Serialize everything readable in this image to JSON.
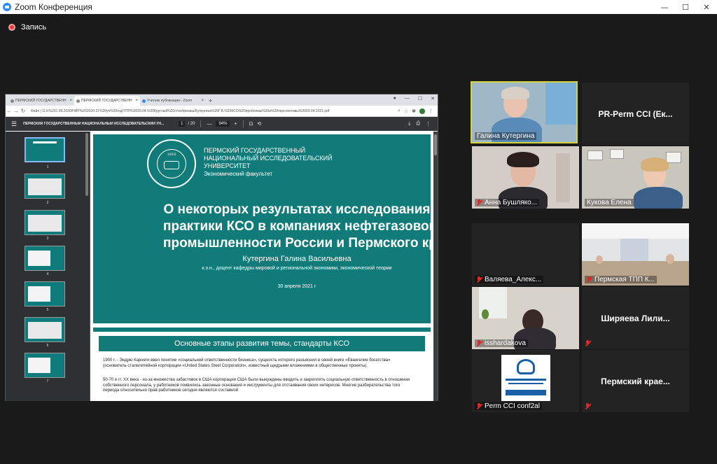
{
  "window": {
    "title": "Zoom Конференция",
    "minimize": "—",
    "maximize": "☐",
    "close": "✕"
  },
  "recording": {
    "label": "Запись"
  },
  "browser": {
    "tabs": [
      {
        "label": "ПЕРМСКИЙ ГОСУДАРСТВЕНН",
        "active": false
      },
      {
        "label": "ПЕРМСКИЙ ГОСУДАРСТВЕНН",
        "active": true
      },
      {
        "label": "Учетник публикации - Zoom",
        "active": false
      }
    ],
    "new_tab": "+",
    "url": "Файл | G:/с%201.09.2020/НИР%202020-21%20уч%20год/ТПП%2029.04.%20Круглый%20стол/финиш/Кутергина%20Г.В.%20КСО%20проблемы%20и%20перспективы%2029.04.2021.pdf"
  },
  "pdf": {
    "doc_title": "ПЕРМСКИЙ ГОСУДАРСТВЕННЫЙ НАЦИОНАЛЬНЫЙ ИССЛЕДОВАТЕЛЬСКИЙ УН...",
    "page_current": "1",
    "page_total": "/ 20",
    "zoom": "94%",
    "thumbnail_numbers": [
      "1",
      "2",
      "3",
      "4",
      "5",
      "6",
      "7"
    ]
  },
  "slide1": {
    "seal_year": "1916",
    "university_lines": [
      "ПЕРМСКИЙ ГОСУДАРСТВЕННЫЙ",
      "НАЦИОНАЛЬНЫЙ ИССЛЕДОВАТЕЛЬСКИЙ",
      "УНИВЕРСИТЕТ"
    ],
    "faculty": "Экономический факультет",
    "title_lines": [
      "О некоторых результатах исследования",
      "практики КСО в компаниях нефтегазовой",
      "промышленности России и Пермского края"
    ],
    "author": "Кутергина Галина Васильевна",
    "degree": "к.э.н., доцент кафедры мировой и региональной экономики, экономической теории",
    "date": "30 апреля 2021 г"
  },
  "slide2": {
    "heading": "Основные этапы развития темы, стандарты КСО",
    "p1": "1900 г. - Эндрю Карнеги ввел понятие «социальной ответственности бизнеса», сущность которого разъяснил в своей книге «Евангелие богатства» (основатель сталелитейной корпорации «United States Steel Corporation», известный щедрыми вложениями в общественные проекты).",
    "p2": "50-70 е гг. XX века - из-за множества забастовок в США корпорации США были вынуждены вводить и закреплять социальную ответственность в отношении собственного персонала, у работников появились законные основания и инструменты для отстаивания своих интересов. Многие разбирательства того периода относительно прав работников сегодня являются составной"
  },
  "participants": [
    {
      "name": "Галина Кутергина",
      "muted": false,
      "video": true
    },
    {
      "name": "PR-Perm CCI (Ек...",
      "muted": false,
      "video": false
    },
    {
      "name": "Анна Бушляко...",
      "muted": true,
      "video": true
    },
    {
      "name": "Кукова Елена",
      "muted": false,
      "video": true
    },
    {
      "name": "Валяева_Алекс...",
      "muted": true,
      "video": false
    },
    {
      "name": "Пермская ТПП К...",
      "muted": true,
      "video": true
    },
    {
      "name": "isshardakova",
      "muted": true,
      "video": true
    },
    {
      "name": "Ширяева Лили...",
      "muted": true,
      "video": false
    },
    {
      "name": "Perm CCI conf2al",
      "muted": true,
      "video": true
    },
    {
      "name": "Пермский крае...",
      "muted": true,
      "video": false
    }
  ],
  "colors": {
    "slide_teal": "#117b79",
    "speaker_border": "#d4d43a",
    "mute_red": "#e02828"
  }
}
